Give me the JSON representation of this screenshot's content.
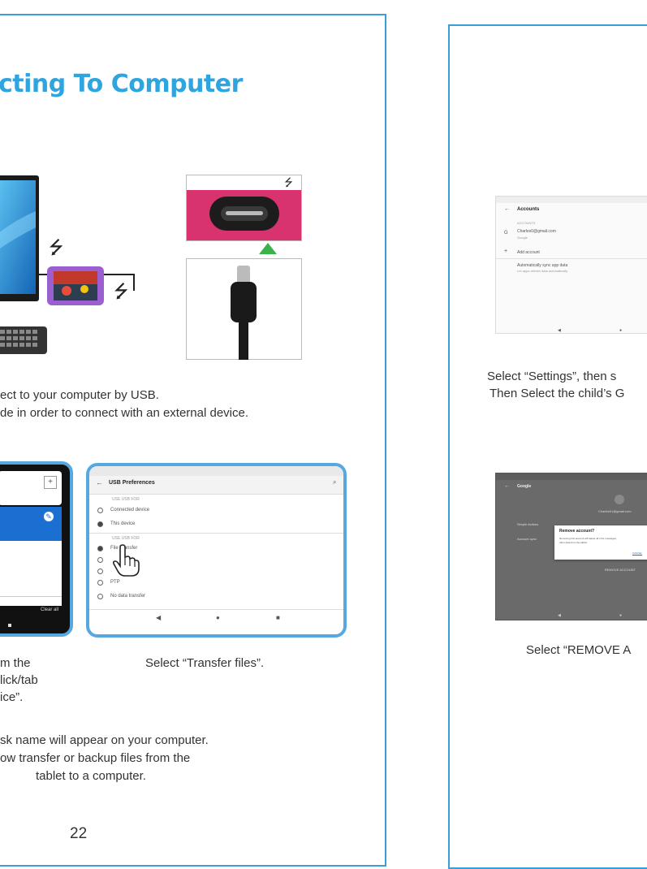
{
  "left_page": {
    "title": "cting To Computer",
    "intro_line1": "ect to your computer by USB.",
    "intro_line2": "de in order to connect with  an external device.",
    "caption_left_line1": "m the",
    "caption_left_line2": "lick/tab",
    "caption_left_line3": "ice”.",
    "caption_right": "Select “Transfer files”.",
    "outro_line1": "sk name will appear on your computer.",
    "outro_line2": "ow transfer or backup files from the",
    "outro_line3": "tablet to a computer.",
    "page_number": "22",
    "usb_prefs": {
      "title": "USB Preferences",
      "section1": "USE USB FOR",
      "opt_connected": "Connected device",
      "opt_this": "This device",
      "section2": "USE USB FOR",
      "opt_file": "File Transfer",
      "opt_ptp": "PTP",
      "opt_nodata": "No data transfer"
    }
  },
  "right_page": {
    "accounts_screen": {
      "title": "Accounts",
      "section": "ACCOUNTS",
      "email": "Charles0@gmail.com",
      "email_sub": "Google",
      "add_account": "Add account",
      "auto_sync": "Automatically sync app data",
      "auto_sync_sub": "Let apps refresh data automatically"
    },
    "caption1_line1": "Select “Settings”, then s",
    "caption1_line2": "Then Select the child’s G",
    "google_screen": {
      "title": "Google",
      "email": "Charles01@gmail.com",
      "row1": "Simple Actions",
      "row2": "Account sync",
      "dialog_title": "Remove account?",
      "dialog_body1": "Removing this account will delete all of its messages,",
      "dialog_body2": "other data from the tablet!",
      "dialog_cancel": "CANCEL",
      "remove_button": "REMOVE ACCOUNT"
    },
    "caption2": "Select “REMOVE A"
  },
  "colors": {
    "accent": "#2fa5e0",
    "border": "#3a9fd8",
    "frame": "#56a9e0",
    "usb_pink": "#d9336f",
    "green_arrow": "#3bb34a"
  }
}
